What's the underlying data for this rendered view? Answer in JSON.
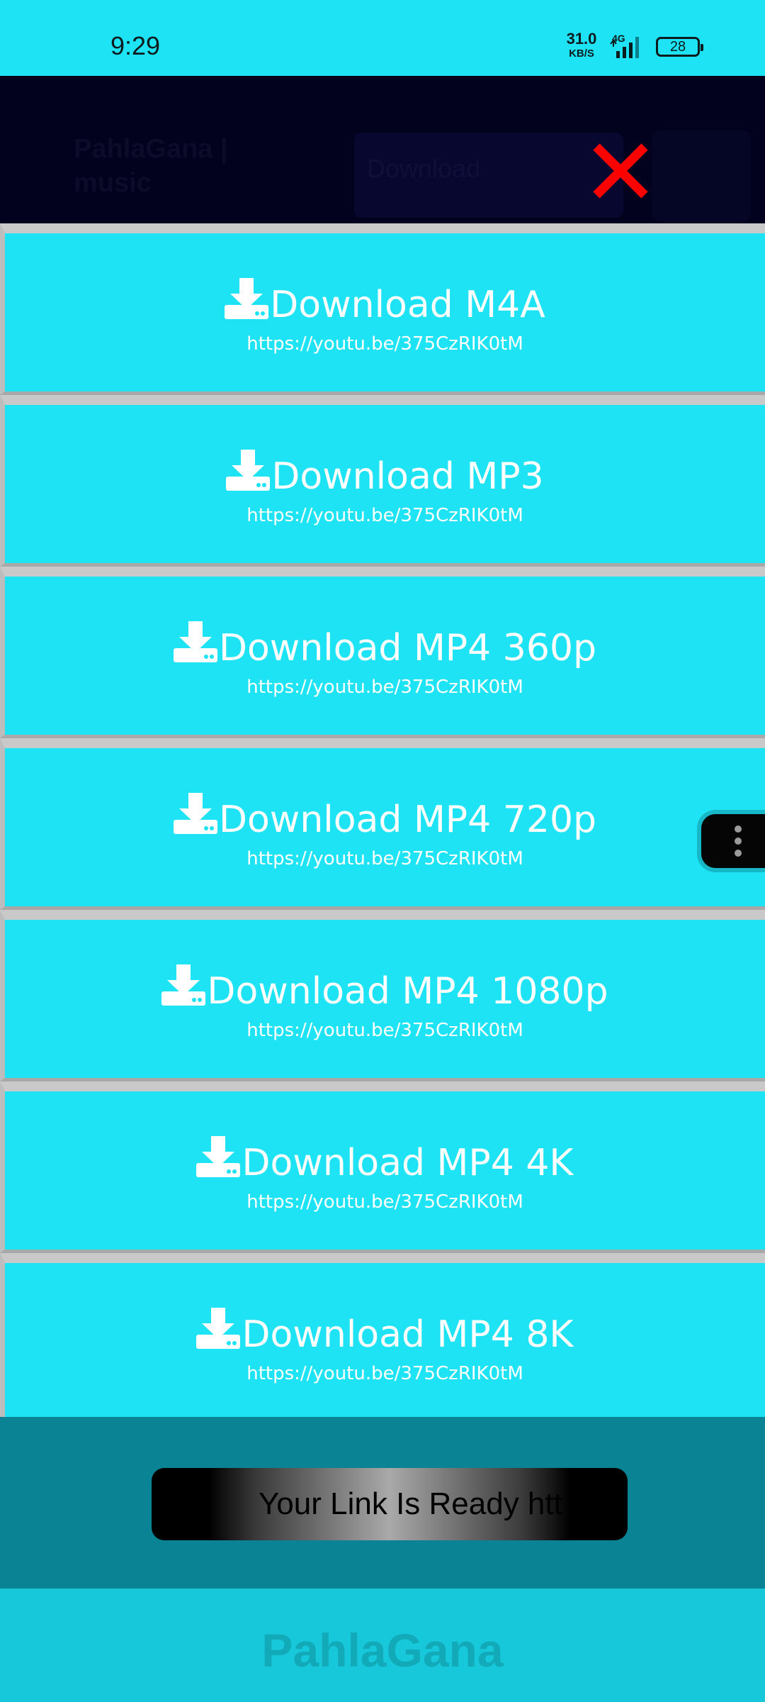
{
  "status_bar": {
    "time": "9:29",
    "net_speed_value": "31.0",
    "net_speed_unit": "KB/S",
    "network_type": "4G",
    "battery": "28"
  },
  "background_app": {
    "title": "PahlaGana | music",
    "search_placeholder": "Download"
  },
  "close_icon": "close-icon",
  "downloads": [
    {
      "label": "Download M4A",
      "url": "https://youtu.be/375CzRIK0tM"
    },
    {
      "label": "Download MP3",
      "url": "https://youtu.be/375CzRIK0tM"
    },
    {
      "label": "Download MP4 360p",
      "url": "https://youtu.be/375CzRIK0tM"
    },
    {
      "label": "Download MP4 720p",
      "url": "https://youtu.be/375CzRIK0tM"
    },
    {
      "label": "Download MP4 1080p",
      "url": "https://youtu.be/375CzRIK0tM"
    },
    {
      "label": "Download MP4 4K",
      "url": "https://youtu.be/375CzRIK0tM"
    },
    {
      "label": "Download MP4 8K",
      "url": "https://youtu.be/375CzRIK0tM"
    }
  ],
  "toast": {
    "text": "Your Link Is Ready htt"
  },
  "footer": {
    "logo": "PahlaGana"
  },
  "colors": {
    "accent": "#1ee3f5",
    "close_red": "#ff0000",
    "dark_header": "#02021f",
    "bottom_teal": "#0a8394"
  }
}
